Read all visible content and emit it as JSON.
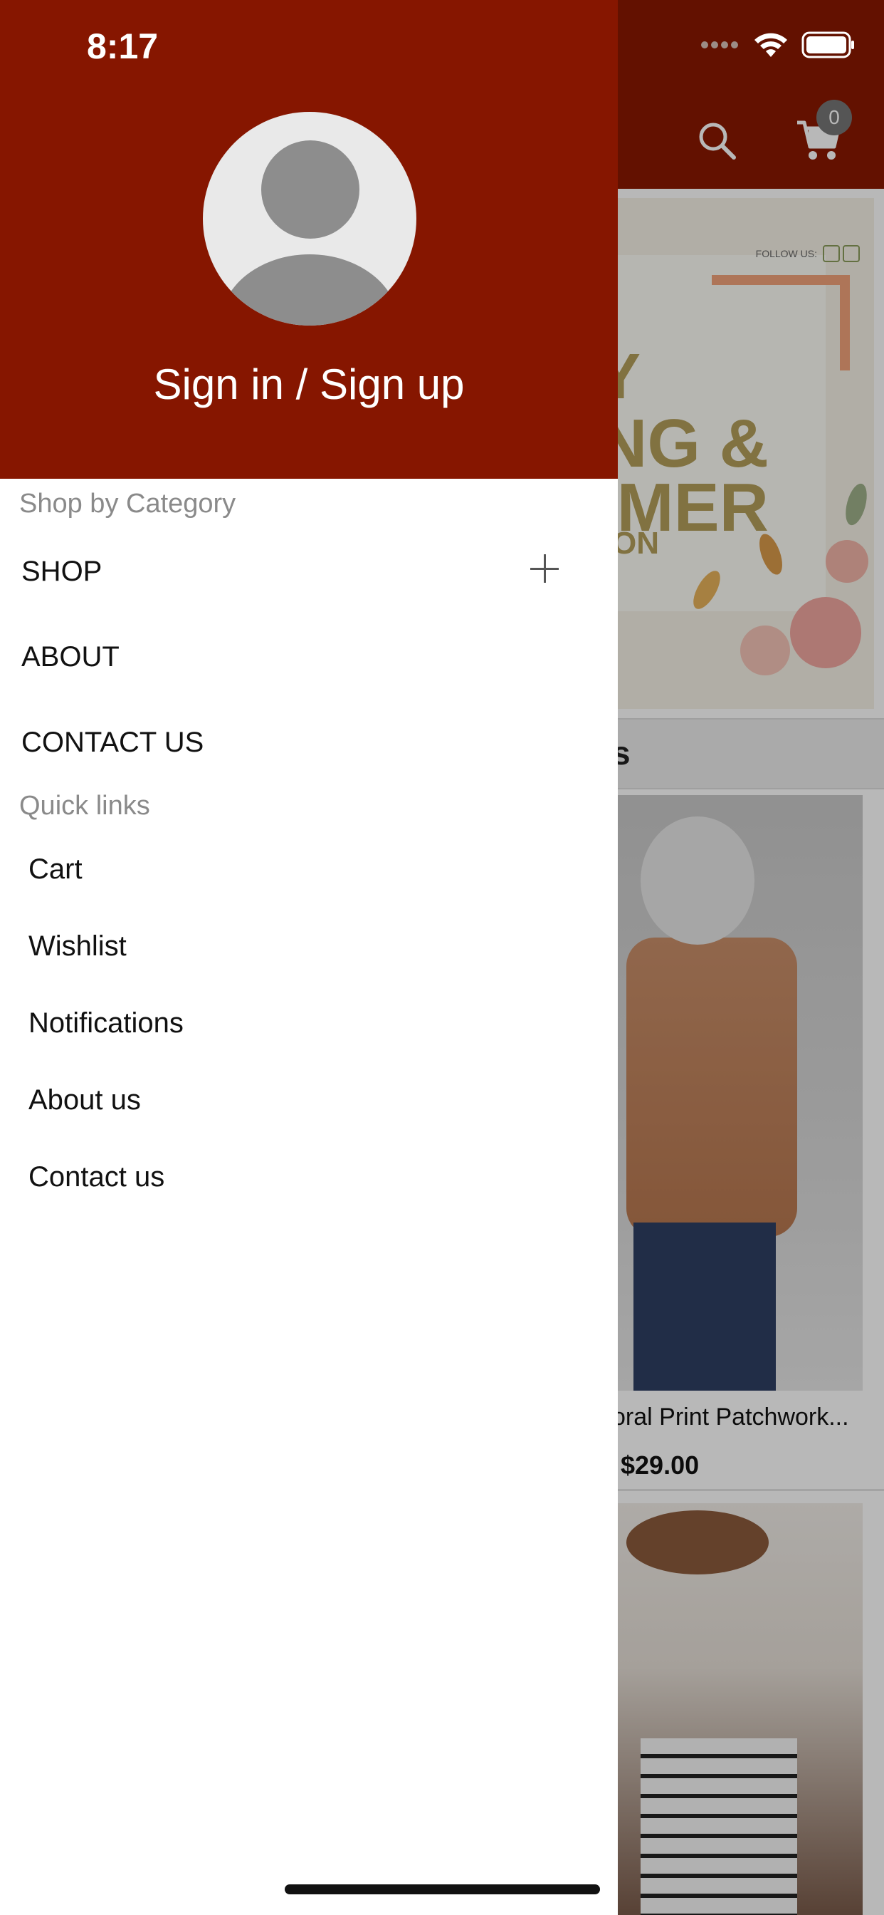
{
  "status_bar": {
    "time": "8:17"
  },
  "background_app": {
    "cart_count": "0",
    "banner": {
      "follow_text": "FOLLOW US:",
      "line1": "Y",
      "line2": "NG &",
      "line3": "IMER",
      "line4": "ON"
    },
    "section_title_fragment": "s",
    "product": {
      "title": "oral Print Patchwork...",
      "price": "$29.00"
    }
  },
  "drawer": {
    "sign_in_label": "Sign in / Sign up",
    "category_heading": "Shop by Category",
    "categories": [
      {
        "label": "SHOP",
        "expandable": true
      },
      {
        "label": "ABOUT"
      },
      {
        "label": "CONTACT US"
      }
    ],
    "quick_links_heading": "Quick links",
    "quick_links": [
      "Cart",
      "Wishlist",
      "Notifications",
      "About us",
      "Contact us"
    ]
  },
  "colors": {
    "drawer_header": "#861600",
    "app_header": "#8a1800",
    "section_label": "#8a8a8a"
  }
}
